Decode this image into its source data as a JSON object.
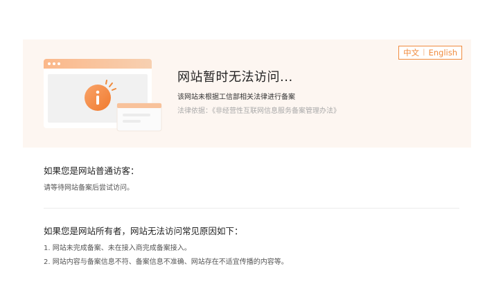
{
  "lang": {
    "zh": "中文",
    "separator": "|",
    "en": "English"
  },
  "notice": {
    "title": "网站暂时无法访问...",
    "subtitle": "该网站未根据工信部相关法律进行备案",
    "law": "法律依据：《非经营性互联网信息服务备案管理办法》"
  },
  "visitor": {
    "heading": "如果您是网站普通访客：",
    "text": "请等待网站备案后尝试访问。"
  },
  "owner": {
    "heading": "如果您是网站所有者，网站无法访问常见原因如下：",
    "reasons": [
      "1. 网站未完成备案、未在接入商完成备案接入。",
      "2. 网站内容与备案信息不符、备案信息不准确、网站存在不适宜传播的内容等。"
    ]
  },
  "colors": {
    "accent": "#f08a3c",
    "banner_bg": "#fdf6f1"
  },
  "icons": {
    "illustration": "browser-warning-illustration",
    "alert": "alert-icon"
  }
}
